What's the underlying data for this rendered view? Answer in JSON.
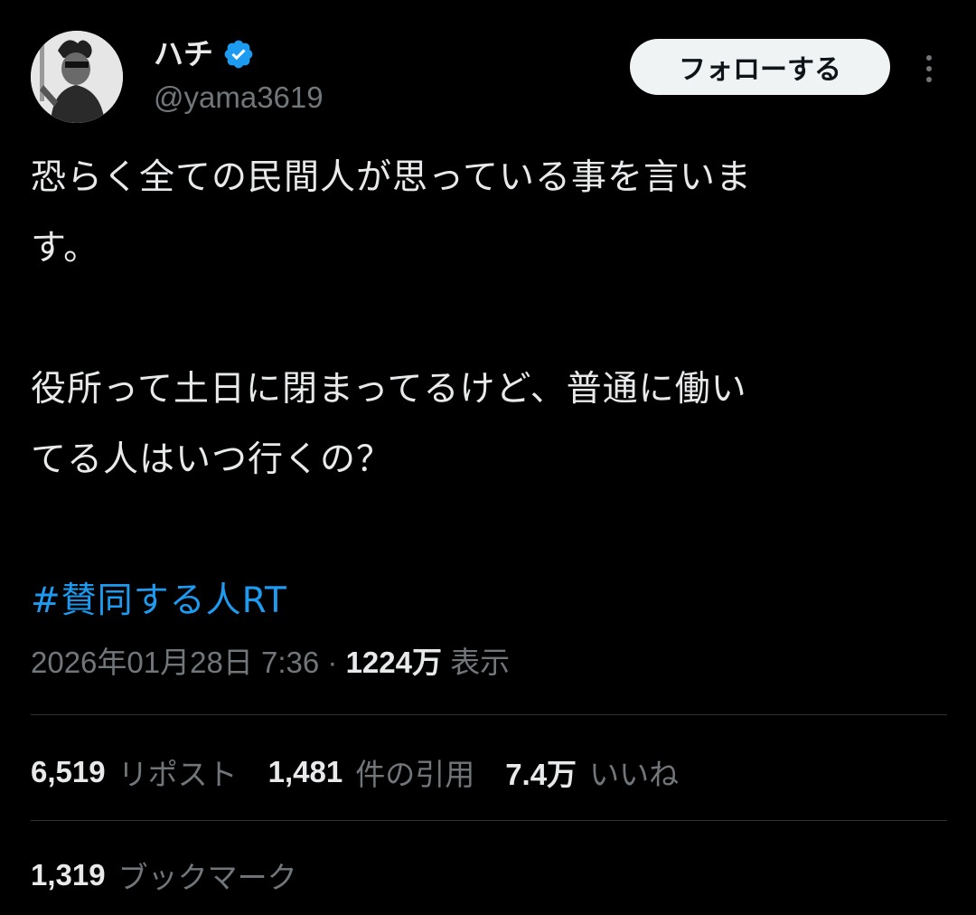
{
  "author": {
    "display_name": "ハチ",
    "handle": "@yama3619",
    "verified_icon": "verified-badge-icon",
    "avatar": "profile-photo"
  },
  "header": {
    "follow_label": "フォローする",
    "more_icon": "more-options-icon"
  },
  "tweet": {
    "lines": [
      "恐らく全ての民間人が思っている事を言いま",
      "す。",
      "役所って土日に閉まってるけど、普通に働い",
      "てる人はいつ行くの？"
    ],
    "hashtag": "#賛同する人RT"
  },
  "meta": {
    "timestamp": "2026年01月28日 7:36",
    "separator": "·",
    "views_count": "1224万",
    "views_label": "表示"
  },
  "stats": {
    "reposts_count": "6,519",
    "reposts_label": "リポスト",
    "quotes_count": "1,481",
    "quotes_label": "件の引用",
    "likes_count": "7.4万",
    "likes_label": "いいね",
    "bookmarks_count": "1,319",
    "bookmarks_label": "ブックマーク"
  },
  "colors": {
    "background": "#000000",
    "text": "#e7e9ea",
    "muted": "#71767b",
    "accent": "#1d9bf0",
    "divider": "#2f3336"
  }
}
